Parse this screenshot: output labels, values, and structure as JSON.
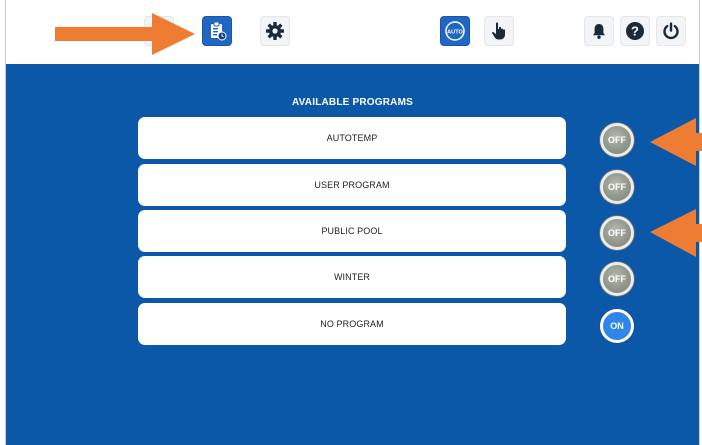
{
  "header": {
    "icons": [
      {
        "name": "home-icon"
      },
      {
        "name": "program-clipboard-icon",
        "active": true
      },
      {
        "name": "gear-icon"
      },
      {
        "name": "auto-mode-icon",
        "label": "AUTO",
        "active": true
      },
      {
        "name": "hand-pointer-icon"
      },
      {
        "name": "bell-icon"
      },
      {
        "name": "help-icon"
      },
      {
        "name": "power-icon"
      }
    ]
  },
  "main": {
    "title": "AVAILABLE PROGRAMS",
    "programs": [
      {
        "label": "AUTOTEMP",
        "toggle": "OFF"
      },
      {
        "label": "USER PROGRAM",
        "toggle": "OFF"
      },
      {
        "label": "PUBLIC POOL",
        "toggle": "OFF"
      },
      {
        "label": "WINTER",
        "toggle": "OFF"
      },
      {
        "label": "NO PROGRAM",
        "toggle": "ON"
      }
    ]
  },
  "colors": {
    "background": "#0b57a8",
    "accent": "#1f67c2",
    "toggle_on": "#2f86e8",
    "toggle_off": "#8f9488",
    "annotation_arrow": "#ee7d33"
  }
}
